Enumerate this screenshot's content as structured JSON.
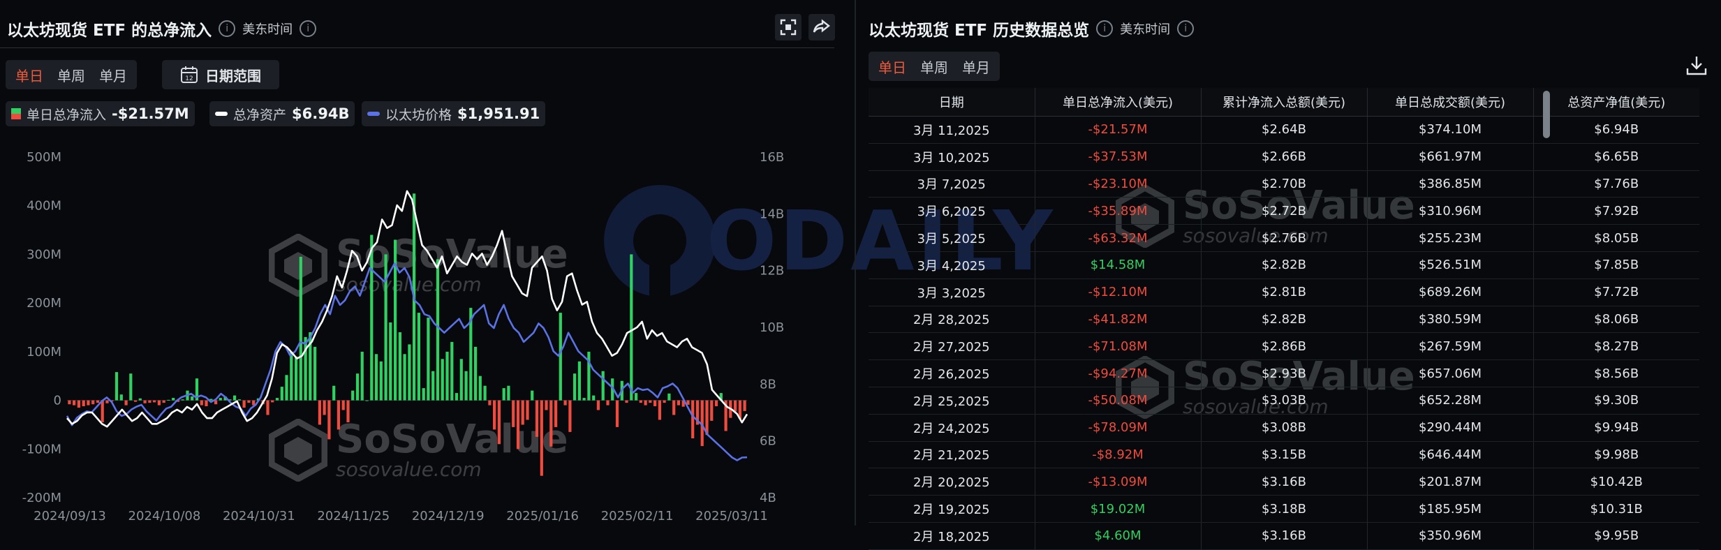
{
  "left": {
    "title": "以太坊现货 ETF 的总净流入",
    "timezone": "美东时间",
    "range_tabs": [
      "单日",
      "单周",
      "单月"
    ],
    "date_range_label": "日期范围",
    "calendar_day": "12",
    "legend": [
      {
        "name": "单日总净流入",
        "value": "-$21.57M"
      },
      {
        "name": "总净资产",
        "value": "$6.94B"
      },
      {
        "name": "以太坊价格",
        "value": "$1,951.91"
      }
    ]
  },
  "right": {
    "title": "以太坊现货 ETF 历史数据总览",
    "timezone": "美东时间",
    "range_tabs": [
      "单日",
      "单周",
      "单月"
    ],
    "columns": [
      "日期",
      "单日总净流入(美元)",
      "累计净流入总额(美元)",
      "单日总成交额(美元)",
      "总资产净值(美元)"
    ],
    "rows": [
      [
        "3月 11,2025",
        "-$21.57M",
        "$2.64B",
        "$374.10M",
        "$6.94B"
      ],
      [
        "3月 10,2025",
        "-$37.53M",
        "$2.66B",
        "$661.97M",
        "$6.65B"
      ],
      [
        "3月 7,2025",
        "-$23.10M",
        "$2.70B",
        "$386.85M",
        "$7.76B"
      ],
      [
        "3月 6,2025",
        "-$35.89M",
        "$2.72B",
        "$310.96M",
        "$7.92B"
      ],
      [
        "3月 5,2025",
        "-$63.32M",
        "$2.76B",
        "$255.23M",
        "$8.05B"
      ],
      [
        "3月 4,2025",
        "$14.58M",
        "$2.82B",
        "$526.51M",
        "$7.85B"
      ],
      [
        "3月 3,2025",
        "-$12.10M",
        "$2.81B",
        "$689.26M",
        "$7.72B"
      ],
      [
        "2月 28,2025",
        "-$41.82M",
        "$2.82B",
        "$380.59M",
        "$8.06B"
      ],
      [
        "2月 27,2025",
        "-$71.08M",
        "$2.86B",
        "$267.59M",
        "$8.27B"
      ],
      [
        "2月 26,2025",
        "-$94.27M",
        "$2.93B",
        "$657.06M",
        "$8.56B"
      ],
      [
        "2月 25,2025",
        "-$50.08M",
        "$3.03B",
        "$652.28M",
        "$9.30B"
      ],
      [
        "2月 24,2025",
        "-$78.09M",
        "$3.08B",
        "$290.44M",
        "$9.94B"
      ],
      [
        "2月 21,2025",
        "-$8.92M",
        "$3.15B",
        "$646.44M",
        "$9.98B"
      ],
      [
        "2月 20,2025",
        "-$13.09M",
        "$3.16B",
        "$201.87M",
        "$10.42B"
      ],
      [
        "2月 19,2025",
        "$19.02M",
        "$3.18B",
        "$185.95M",
        "$10.31B"
      ],
      [
        "2月 18,2025",
        "$4.60M",
        "$3.16B",
        "$350.96M",
        "$9.95B"
      ]
    ]
  },
  "watermark": {
    "brand": "SoSoValue",
    "url": "sosovalue.com",
    "odaily": "ODAILY"
  },
  "colors": {
    "inflow": "#2fd162",
    "outflow": "#ef4b3e",
    "assets_line": "#ffffff",
    "price_line": "#5b72e6",
    "accent": "#f05a3a"
  },
  "icons": [
    "info-icon",
    "calendar-icon",
    "fullscreen-icon",
    "share-icon",
    "download-icon"
  ],
  "chart_data": {
    "type": "bar+line",
    "x_tick_labels": [
      "2024/09/13",
      "2024/10/08",
      "2024/10/31",
      "2024/11/25",
      "2024/12/19",
      "2025/01/16",
      "2025/02/11",
      "2025/03/11"
    ],
    "y_left_ticks": [
      "500M",
      "400M",
      "300M",
      "200M",
      "100M",
      "0",
      "-100M",
      "-200M"
    ],
    "y_left_range_musd": [
      -200,
      500
    ],
    "y_right_ticks": [
      "16B",
      "14B",
      "12B",
      "10B",
      "8B",
      "6B",
      "4B"
    ],
    "y_right_range_busd": [
      4,
      16
    ],
    "grid": false,
    "series": [
      {
        "name": "单日总净流入",
        "kind": "bar",
        "unit": "M USD",
        "values": [
          -8,
          -10,
          -15,
          -12,
          -10,
          -8,
          -5,
          -45,
          -6,
          -2,
          58,
          12,
          -10,
          55,
          -3,
          4,
          -6,
          -5,
          -4,
          -10,
          -5,
          1,
          5,
          -3,
          2,
          20,
          8,
          45,
          -10,
          -12,
          3,
          -8,
          5,
          8,
          2,
          10,
          2,
          -15,
          -5,
          -10,
          4,
          -8,
          -30,
          -4,
          5,
          28,
          52,
          100,
          90,
          295,
          130,
          140,
          110,
          -50,
          -30,
          -80,
          30,
          -60,
          -20,
          -45,
          20,
          55,
          100,
          0,
          340,
          95,
          80,
          300,
          160,
          330,
          140,
          95,
          115,
          425,
          180,
          25,
          170,
          60,
          290,
          85,
          100,
          120,
          15,
          85,
          60,
          190,
          110,
          50,
          30,
          -10,
          -60,
          -90,
          25,
          30,
          -55,
          -100,
          -50,
          -40,
          20,
          -75,
          -155,
          -20,
          -95,
          -55,
          180,
          -10,
          -65,
          55,
          80,
          5,
          100,
          10,
          -20,
          60,
          -10,
          45,
          -55,
          40,
          -5,
          300,
          15,
          -5,
          -10,
          -5,
          -12,
          -40,
          -5,
          14,
          -30,
          -10,
          -13,
          -9,
          -78,
          -50,
          -94,
          -71,
          -42,
          -12,
          15,
          -63,
          -36,
          -23,
          -38,
          -22
        ]
      },
      {
        "name": "总净资产",
        "kind": "line",
        "unit": "B USD",
        "values": [
          6.8,
          6.6,
          6.7,
          6.9,
          7.0,
          7.0,
          6.8,
          6.6,
          6.5,
          6.7,
          6.9,
          7.1,
          6.9,
          6.7,
          6.8,
          7.0,
          6.8,
          6.6,
          6.6,
          6.7,
          6.8,
          7.0,
          7.1,
          7.0,
          7.2,
          7.1,
          7.3,
          7.0,
          6.8,
          6.8,
          7.0,
          7.1,
          7.2,
          7.3,
          7.4,
          7.0,
          6.7,
          6.8,
          7.0,
          7.3,
          7.6,
          8.2,
          9.1,
          9.4,
          9.3,
          9.1,
          8.9,
          9.0,
          9.3,
          9.5,
          9.9,
          10.2,
          10.6,
          11.1,
          11.8,
          11.4,
          12.0,
          12.7,
          12.5,
          12.0,
          12.3,
          12.8,
          13.0,
          13.8,
          13.5,
          13.6,
          14.3,
          14.1,
          14.8,
          14.5,
          13.7,
          12.9,
          12.7,
          12.4,
          12.1,
          12.5,
          11.9,
          12.2,
          12.5,
          12.3,
          12.2,
          12.6,
          12.4,
          12.6,
          12.2,
          12.5,
          12.9,
          13.4,
          12.6,
          11.8,
          11.5,
          11.2,
          11.1,
          12.1,
          12.3,
          12.5,
          12.0,
          11.0,
          10.6,
          10.9,
          11.8,
          11.9,
          11.3,
          10.8,
          10.9,
          10.2,
          9.8,
          9.6,
          9.3,
          9.0,
          9.1,
          9.4,
          9.8,
          9.9,
          10.0,
          10.2,
          9.6,
          9.9,
          9.7,
          9.8,
          9.5,
          9.4,
          9.3,
          9.5,
          9.6,
          9.3,
          9.2,
          9.1,
          8.7,
          7.8,
          7.6,
          7.4,
          7.2,
          7.1,
          6.95,
          6.65,
          6.94
        ]
      },
      {
        "name": "以太坊价格",
        "kind": "line",
        "unit": "USD",
        "values": [
          2400,
          2300,
          2380,
          2420,
          2450,
          2440,
          2500,
          2560,
          2600,
          2550,
          2450,
          2400,
          2420,
          2470,
          2500,
          2520,
          2450,
          2400,
          2350,
          2420,
          2480,
          2500,
          2560,
          2600,
          2620,
          2640,
          2600,
          2620,
          2600,
          2550,
          2580,
          2640,
          2600,
          2540,
          2500,
          2480,
          2400,
          2480,
          2520,
          2600,
          2750,
          2900,
          3100,
          3200,
          3150,
          3050,
          3100,
          3200,
          3180,
          3250,
          3350,
          3500,
          3600,
          3500,
          3700,
          3600,
          3650,
          3750,
          3800,
          3700,
          3850,
          4000,
          3950,
          3900,
          3850,
          3950,
          4050,
          3950,
          4000,
          3900,
          3650,
          3600,
          3500,
          3480,
          3400,
          3350,
          3300,
          3350,
          3400,
          3450,
          3350,
          3400,
          3500,
          3550,
          3600,
          3400,
          3350,
          3500,
          3600,
          3450,
          3350,
          3300,
          3200,
          3250,
          3300,
          3400,
          3350,
          3250,
          3100,
          3050,
          3150,
          3300,
          3200,
          3100,
          3050,
          3000,
          2900,
          2850,
          2800,
          2750,
          2700,
          2600,
          2700,
          2750,
          2650,
          2700,
          2680,
          2690,
          2650,
          2600,
          2700,
          2720,
          2750,
          2700,
          2600,
          2500,
          2400,
          2350,
          2300,
          2200,
          2150,
          2100,
          2050,
          2000,
          1950,
          1920,
          1950,
          1951.91
        ]
      }
    ]
  }
}
